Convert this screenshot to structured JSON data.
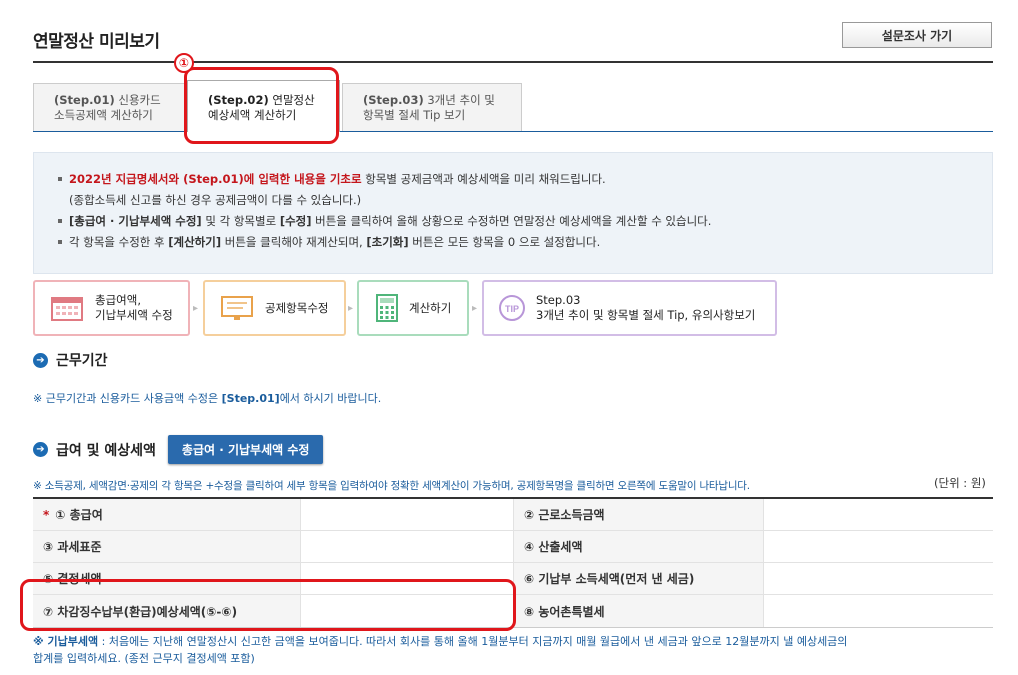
{
  "page": {
    "title": "연말정산 미리보기",
    "survey_button": "설문조사 가기"
  },
  "tabs": [
    {
      "step": "(Step.01)",
      "line1": "신용카드",
      "line2": "소득공제액 계산하기"
    },
    {
      "step": "(Step.02)",
      "line1": "연말정산",
      "line2": "예상세액 계산하기"
    },
    {
      "step": "(Step.03)",
      "line1": "3개년 추이 및",
      "line2": "항목별 절세 Tip 보기"
    }
  ],
  "annotation": {
    "marker": "①"
  },
  "info": {
    "line1_red": "2022년 지급명세서와 (Step.01)에 입력한 내용을 기초로",
    "line1_rest": " 항목별 공제금액과 예상세액을 미리 채워드립니다.",
    "line1_sub": "(종합소득세 신고를 하신 경우 공제금액이 다를 수 있습니다.)",
    "line2_b1": "[총급여 · 기납부세액 수정]",
    "line2_t1": " 및 각 항목별로 ",
    "line2_b2": "[수정]",
    "line2_t2": " 버튼을 클릭하여 올해 상황으로 수정하면 연말정산 예상세액을 계산할 수 있습니다.",
    "line3_t1": "각 항목을 수정한 후 ",
    "line3_b1": "[계산하기]",
    "line3_t2": " 버튼을 클릭해야 재계산되며, ",
    "line3_b2": "[초기화]",
    "line3_t3": " 버튼은 모든 항목을 0 으로 설정합니다."
  },
  "steps": [
    {
      "label1": "총급여액,",
      "label2": "기납부세액 수정",
      "icon": "calendar-icon",
      "color": "#f0b3b8"
    },
    {
      "label1": "공제항목수정",
      "label2": "",
      "icon": "monitor-icon",
      "color": "#f5cf9c"
    },
    {
      "label1": "계산하기",
      "label2": "",
      "icon": "calculator-icon",
      "color": "#a9dcbc"
    },
    {
      "label1": "Step.03",
      "label2": "3개년 추이 및 항목별 절세 Tip, 유의사항보기",
      "icon": "tip-icon",
      "color": "#d2bde6"
    }
  ],
  "work_period": {
    "heading": "근무기간",
    "note_pre": "※ 근무기간과 신용카드 사용금액 수정은 ",
    "note_bold": "[Step.01]",
    "note_post": "에서 하시기 바랍니다."
  },
  "salary": {
    "heading": "급여 및 예상세액",
    "button": "총급여 · 기납부세액 수정",
    "note": "※ 소득공제, 세액감면·공제의 각 항목은 +수정을 클릭하여 세부 항목을 입력하여야 정확한 세액계산이 가능하며, 공제항목명을 클릭하면 오른쪽에 도움말이 나타납니다.",
    "unit": "(단위 : 원)",
    "rows": [
      {
        "left": "① 총급여",
        "left_required": "*",
        "right": "② 근로소득금액"
      },
      {
        "left": "③ 과세표준",
        "left_required": "",
        "right": "④ 산출세액"
      },
      {
        "left": "⑤ 결정세액",
        "left_required": "",
        "right": "⑥ 기납부 소득세액(먼저 낸 세금)"
      },
      {
        "left": "⑦ 차감징수납부(환급)예상세액(⑤-⑥)",
        "left_required": "",
        "right": "⑧ 농어촌특별세"
      }
    ]
  },
  "footnote": {
    "bold": "※ 기납부세액",
    "text1": " : 처음에는 지난해 연말정산시 신고한 금액을 보여줍니다. 따라서 회사를 통해 올해 1월분부터 지금까지 매월 월급에서 낸 세금과 앞으로 12월분까지 낼 예상세금의",
    "text2": "합계를 입력하세요. (종전 근무지 결정세액 포함)"
  },
  "colors": {
    "accent_red": "#e0161b",
    "brand_blue": "#1c6bb3",
    "button_blue": "#2a6aad"
  }
}
